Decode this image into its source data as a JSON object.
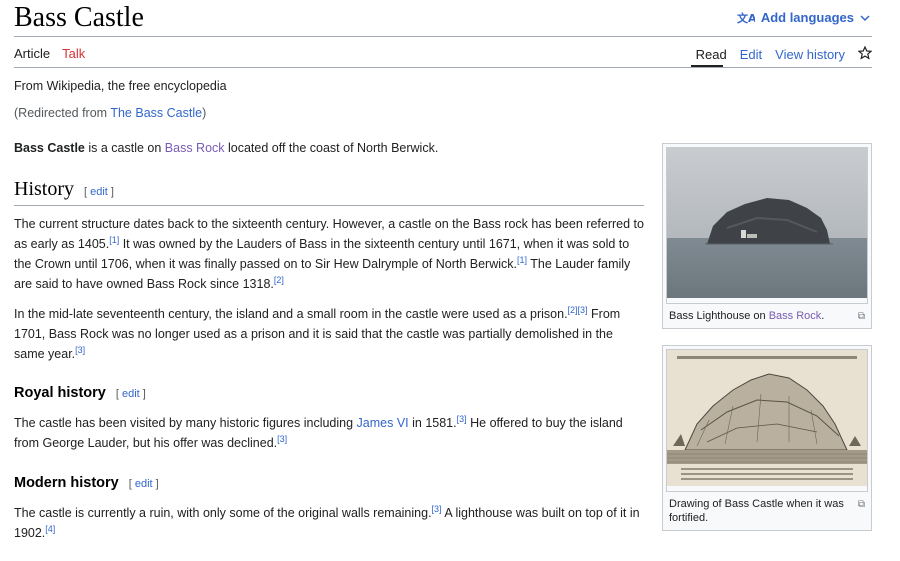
{
  "page": {
    "title": "Bass Castle",
    "add_languages": "Add languages",
    "tabs_left": {
      "article": "Article",
      "talk": "Talk"
    },
    "tabs_right": {
      "read": "Read",
      "edit": "Edit",
      "view_history": "View history"
    },
    "tagline": "From Wikipedia, the free encyclopedia",
    "redirect_prefix": "(Redirected from ",
    "redirect_link": "The Bass Castle",
    "redirect_suffix": ")"
  },
  "intro": {
    "bold": "Bass Castle",
    "t1": " is a castle on ",
    "link": "Bass Rock",
    "t2": " located off the coast of North Berwick."
  },
  "history": {
    "heading": "History",
    "edit_open": "[ ",
    "edit": "edit",
    "edit_close": " ]",
    "p1": {
      "a": "The current structure dates back to the sixteenth century. However, a castle on the Bass rock has been referred to as early as 1405.",
      "r1": "[1]",
      "b": " It was owned by the Lauders of Bass in the sixteenth century until 1671, when it was sold to the Crown until 1706, when it was finally passed on to Sir Hew Dalrymple of North Berwick.",
      "r2": "[1]",
      "c": " The Lauder family are said to have owned Bass Rock since 1318.",
      "r3": "[2]"
    },
    "p2": {
      "a": "In the mid-late seventeenth century, the island and a small room in the castle were used as a prison.",
      "r1": "[2][3]",
      "b": " From 1701, Bass Rock was no longer used as a prison and it is said that the castle was partially demolished in the same year.",
      "r2": "[3]"
    }
  },
  "royal": {
    "heading": "Royal history",
    "edit": "edit",
    "p": {
      "a": "The castle has been visited by many historic figures including ",
      "link": "James VI",
      "b": " in 1581.",
      "r1": "[3]",
      "c": " He offered to buy the island from George Lauder, but his offer was declined.",
      "r2": "[3]"
    }
  },
  "modern": {
    "heading": "Modern history",
    "edit": "edit",
    "p": {
      "a": "The castle is currently a ruin, with only some of the original walls remaining.",
      "r1": "[3]",
      "b": " A lighthouse was built on top of it in 1902.",
      "r2": "[4]"
    }
  },
  "figures": {
    "photo": {
      "cap1": "Bass Lighthouse on ",
      "cap_link": "Bass Rock",
      "cap2": "."
    },
    "drawing": {
      "cap": "Drawing of Bass Castle when it was fortified."
    }
  }
}
